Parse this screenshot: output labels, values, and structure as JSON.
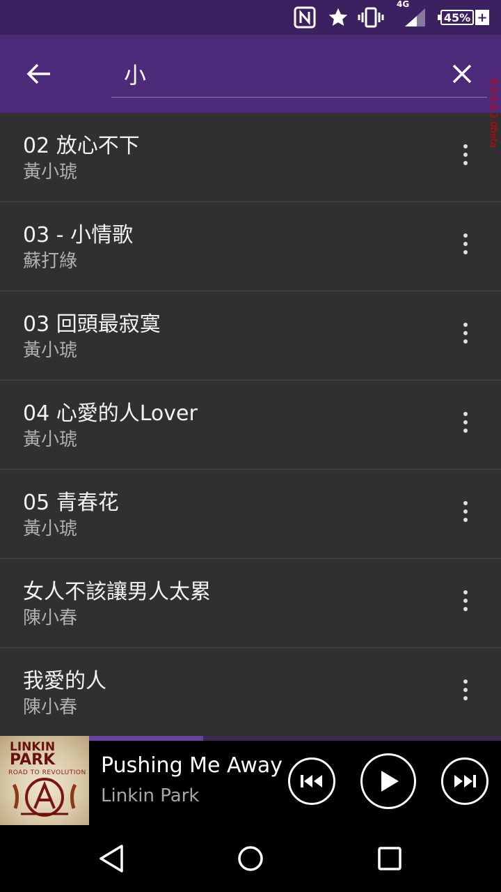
{
  "status_bar": {
    "battery_percent": "45%",
    "network_type": "4G",
    "charging_symbol": "+",
    "icons": [
      "nfc-icon",
      "star-icon",
      "vibrate-icon",
      "signal-icon",
      "battery-icon"
    ]
  },
  "app_bar": {
    "search_query": "小",
    "version_tag": "9.0.0.A.2.0beta",
    "icons": [
      "back-arrow-icon",
      "close-icon"
    ]
  },
  "songs": [
    {
      "title": "02 放心不下",
      "artist": "黃小琥"
    },
    {
      "title": "03 - 小情歌",
      "artist": "蘇打綠"
    },
    {
      "title": "03 回頭最寂寞",
      "artist": "黃小琥"
    },
    {
      "title": "04 心愛的人Lover",
      "artist": "黃小琥"
    },
    {
      "title": "05 青春花",
      "artist": "黃小琥"
    },
    {
      "title": "女人不該讓男人太累",
      "artist": "陳小春"
    },
    {
      "title": "我愛的人",
      "artist": "陳小春"
    }
  ],
  "now_playing": {
    "title": "Pushing Me Away",
    "artist": "Linkin Park",
    "album_art_text": [
      "LINKIN",
      "PARK",
      "ROAD TO REVOLUTION"
    ],
    "progress_fraction": 0.405,
    "icons": [
      "previous-track-icon",
      "play-icon",
      "next-track-icon"
    ]
  },
  "colors": {
    "status_bar": "#3c2160",
    "app_bar": "#4e2a7a",
    "list_bg": "#303030",
    "progress": "#6a3fa2",
    "version_tag": "#d40000"
  },
  "nav_bar": {
    "icons": [
      "back-triangle-icon",
      "home-circle-icon",
      "recents-square-icon"
    ]
  }
}
